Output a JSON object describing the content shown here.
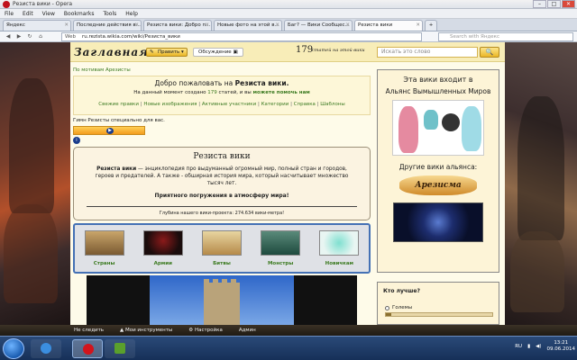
{
  "window": {
    "title": "Резиста вики - Opera"
  },
  "menu": [
    "File",
    "Edit",
    "View",
    "Bookmarks",
    "Tools",
    "Help"
  ],
  "tabs": [
    {
      "label": "Яндекс",
      "active": false
    },
    {
      "label": "Последние действия в...",
      "active": false
    },
    {
      "label": "Резиста вики: Добро п...",
      "active": false
    },
    {
      "label": "Новые фото на этой в...",
      "active": false
    },
    {
      "label": "Баг? — Вики Сообщес...",
      "active": false
    },
    {
      "label": "Резиста вики",
      "active": true
    }
  ],
  "nav": {
    "web_label": "Web",
    "url": "ru.rezista.wikia.com/wiki/Резиста_вики",
    "search_placeholder": "Search with Яндекс"
  },
  "wiki": {
    "logo": "Заглавная",
    "edit_label": "Править",
    "discuss_label": "Обсуждение",
    "article_count": "179",
    "article_count_text": "статей на этой вики",
    "search_placeholder": "Искать это слово",
    "motive": "По мотивам Арезисты",
    "welcome_prefix": "Добро пожаловать на ",
    "welcome_name": "Резиста вики.",
    "now_prefix": "На данный момент создано ",
    "now_count": "179",
    "now_mid": " статей, и вы ",
    "now_link": "можете помочь нам",
    "quicklinks": [
      "Свежие правки",
      "Новые изображения",
      "Активные участники",
      "Категории",
      "Справка",
      "Шаблоны"
    ],
    "anthem": "Гимн Резисты специально для вас.",
    "intro_title": "Резиста вики",
    "intro_bold": "Резиста вики",
    "intro_text": " — энциклопедия про выдуманный огромный мир, полный стран и городов, героев и предателей. А также - обширная история мира, который насчитывает множество тысяч лет.",
    "enjoy": "Приятного погружения в атмосферу мира!",
    "depth": "Глубина нашего вики-проекта: 274.634 вики-метра!",
    "portals": [
      "Страны",
      "Армии",
      "Битвы",
      "Монстры",
      "Новичкам"
    ]
  },
  "sidebar": {
    "alliance_title": "Эта вики входит в",
    "alliance_name": "Альянс Вымышленных Миров",
    "other_wikis": "Другие вики альянса:",
    "arezisma": "Арезисма",
    "poll_question": "Кто лучше?",
    "poll_option": "Големы",
    "poll_option_fraction": 0.05
  },
  "status": [
    "Не следить",
    "Мои инструменты",
    "Настройка",
    "Админ"
  ],
  "taskbar": {
    "lang": "RU",
    "time": "13:21",
    "date": "09.06.2014"
  }
}
